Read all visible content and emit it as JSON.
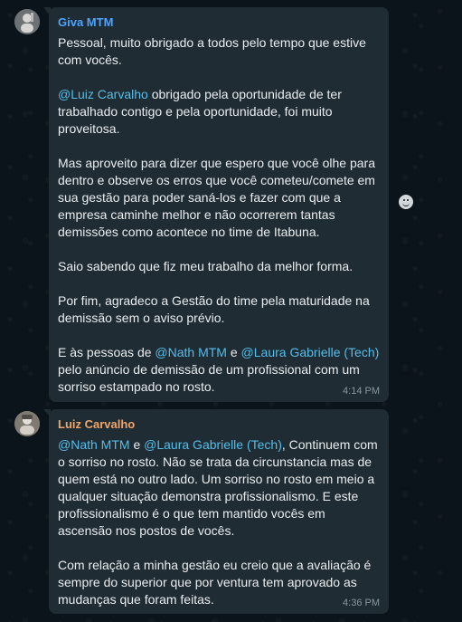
{
  "chat": {
    "messages": [
      {
        "sender": "Giva MTM",
        "time": "4:14 PM",
        "paragraphs": [
          [
            {
              "t": "Pessoal, muito obrigado a todos pelo tempo que estive com vocês."
            }
          ],
          [
            {
              "t": "@Luiz Carvalho",
              "mention": true
            },
            {
              "t": " obrigado pela oportunidade de ter trabalhado contigo e pela oportunidade, foi muito proveitosa."
            }
          ],
          [
            {
              "t": "Mas aproveito para dizer que espero que você olhe para dentro e observe os erros que você cometeu/comete em sua gestão para poder saná-los e fazer com que a empresa caminhe melhor e não ocorrerem tantas demissões como acontece no time de Itabuna."
            }
          ],
          [
            {
              "t": "Saio sabendo que fiz meu trabalho da melhor forma."
            }
          ],
          [
            {
              "t": "Por fim, agradeco a Gestão do time pela maturidade na demissão sem o aviso prévio."
            }
          ],
          [
            {
              "t": "E às pessoas de "
            },
            {
              "t": "@Nath MTM",
              "mention": true
            },
            {
              "t": " e "
            },
            {
              "t": "@Laura Gabrielle (Tech)",
              "mention": true
            },
            {
              "t": " pelo anúncio de demissão de um profissional com um sorriso estampado no rosto."
            }
          ]
        ]
      },
      {
        "sender": "Luiz Carvalho",
        "time": "4:36 PM",
        "paragraphs": [
          [
            {
              "t": "@Nath MTM",
              "mention": true
            },
            {
              "t": " e "
            },
            {
              "t": "@Laura Gabrielle (Tech)",
              "mention": true
            },
            {
              "t": ", Continuem com o sorriso no rosto. Não se trata da circunstancia mas de quem está no outro lado. Um sorriso no rosto em meio a qualquer situação demonstra profissionalismo. E este profissionalismo é o que tem mantido vocês em ascensão nos postos de vocês."
            }
          ],
          [
            {
              "t": "Com relação a minha gestão eu creio que a avaliação é sempre do superior que por ventura tem aprovado as mudanças que foram feitas."
            }
          ]
        ]
      }
    ],
    "reaction_icon": "smiley-icon"
  }
}
